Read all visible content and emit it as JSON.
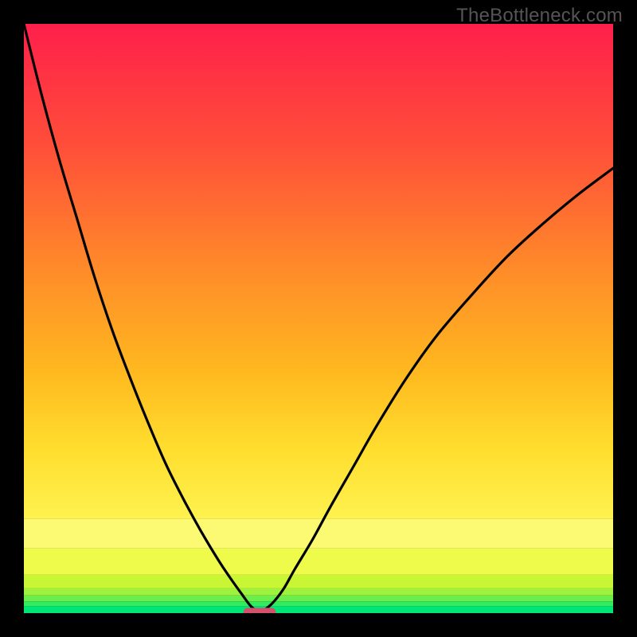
{
  "watermark": "TheBottleneck.com",
  "chart_data": {
    "type": "line",
    "title": "",
    "xlabel": "",
    "ylabel": "",
    "xrange": [
      0,
      100
    ],
    "ylim": [
      0,
      100
    ],
    "optimum_x": 40,
    "series": [
      {
        "name": "left-branch",
        "x": [
          0,
          3,
          6,
          9,
          12,
          15,
          18,
          21,
          24,
          27,
          30,
          33,
          35,
          37,
          38.5,
          40
        ],
        "y": [
          100,
          88,
          77,
          67,
          57,
          48,
          40,
          32.5,
          25.5,
          19.5,
          14,
          9,
          6,
          3.2,
          1.2,
          0
        ]
      },
      {
        "name": "right-branch",
        "x": [
          40,
          42,
          44,
          46,
          49,
          52,
          56,
          60,
          65,
          70,
          76,
          82,
          88,
          94,
          100
        ],
        "y": [
          0,
          1.5,
          4,
          7.5,
          12.5,
          18,
          25,
          32,
          40,
          47,
          54,
          60.5,
          66,
          71,
          75.5
        ]
      }
    ],
    "bands": [
      {
        "y0": 0.0,
        "y1": 1.2,
        "color": "#00e676"
      },
      {
        "y0": 1.2,
        "y1": 2.0,
        "color": "#34ea5e"
      },
      {
        "y0": 2.0,
        "y1": 3.0,
        "color": "#6bee4c"
      },
      {
        "y0": 3.0,
        "y1": 4.2,
        "color": "#9df23d"
      },
      {
        "y0": 4.2,
        "y1": 6.5,
        "color": "#c8f634"
      },
      {
        "y0": 6.5,
        "y1": 11,
        "color": "#eefb4a"
      },
      {
        "y0": 11,
        "y1": 16,
        "color": "#fbfa72"
      },
      {
        "y0": 16,
        "y1": 100,
        "gradient": true
      }
    ],
    "gradient_stops": [
      {
        "offset": 0.0,
        "color": "#ff1f4b"
      },
      {
        "offset": 0.25,
        "color": "#ff4f39"
      },
      {
        "offset": 0.5,
        "color": "#ff8c29"
      },
      {
        "offset": 0.7,
        "color": "#ffb81f"
      },
      {
        "offset": 0.86,
        "color": "#ffde2e"
      },
      {
        "offset": 1.0,
        "color": "#fff24f"
      }
    ],
    "marker": {
      "x": 40,
      "y": 0,
      "w": 5.5,
      "h": 1.5,
      "color": "#d3516a"
    }
  }
}
